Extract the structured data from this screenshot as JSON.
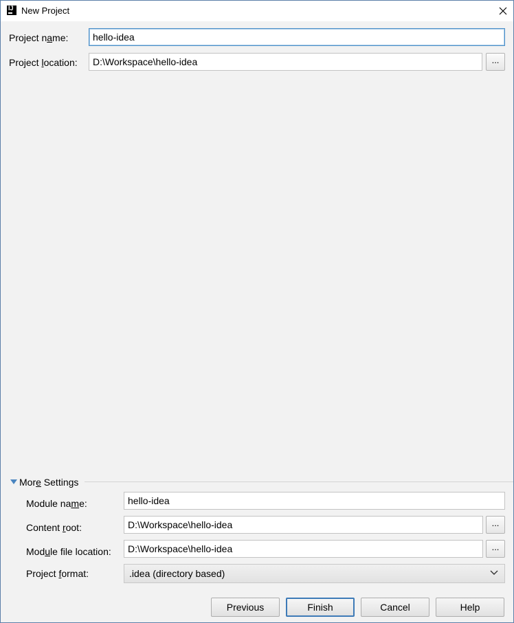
{
  "window": {
    "title": "New Project",
    "close_glyph": "✕",
    "app_icon": "intellij-idea-icon",
    "app_icon_text": "IJ"
  },
  "project": {
    "name_label": {
      "pre": "Project n",
      "u": "a",
      "post": "me:"
    },
    "name_value": "hello-idea",
    "location_label": {
      "pre": "Project ",
      "u": "l",
      "post": "ocation:"
    },
    "location_value": "D:\\Workspace\\hello-idea",
    "browse_label": "..."
  },
  "more_settings": {
    "label": {
      "pre": "Mor",
      "u": "e",
      "post": " Settings"
    },
    "expanded": true,
    "module_name_label": {
      "pre": "Module na",
      "u": "m",
      "post": "e:"
    },
    "module_name_value": "hello-idea",
    "content_root_label": {
      "pre": "Content ",
      "u": "r",
      "post": "oot:"
    },
    "content_root_value": "D:\\Workspace\\hello-idea",
    "module_file_label": {
      "pre": "Mod",
      "u": "u",
      "post": "le file location:"
    },
    "module_file_value": "D:\\Workspace\\hello-idea",
    "project_format_label": {
      "pre": "Project ",
      "u": "f",
      "post": "ormat:"
    },
    "project_format_value": ".idea (directory based)",
    "browse_label": "..."
  },
  "buttons": {
    "previous": "Previous",
    "finish": "Finish",
    "cancel": "Cancel",
    "help": "Help"
  },
  "colors": {
    "accent": "#4e91c9",
    "default_button_border": "#3d7ab7",
    "triangle": "#4a85c0"
  }
}
